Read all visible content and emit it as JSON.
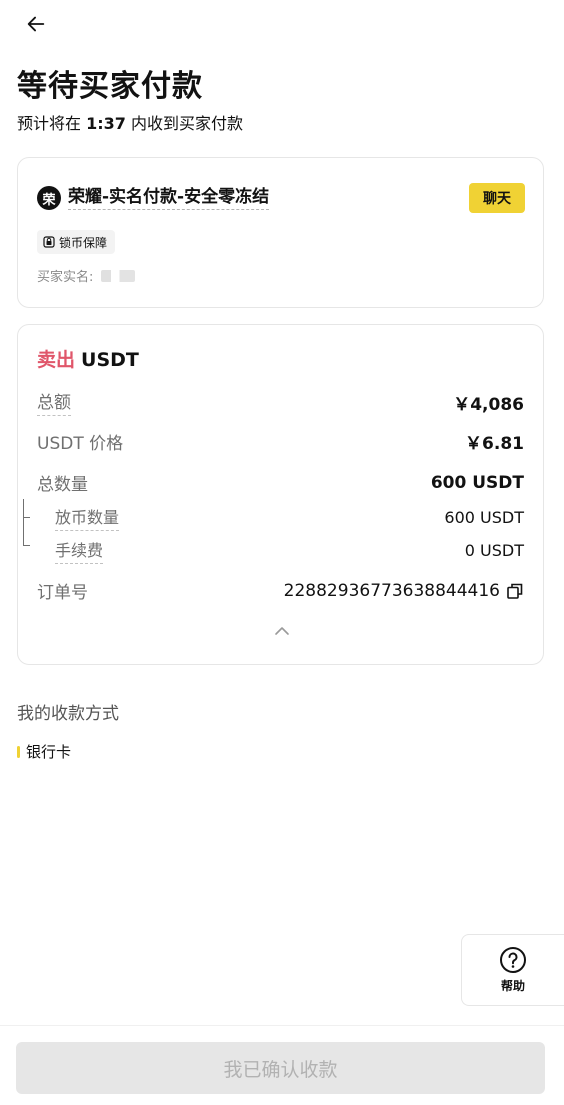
{
  "header": {
    "back_icon": "arrow-left-icon",
    "title": "等待买家付款",
    "subtitle_prefix": "预计将在",
    "countdown": "1:37",
    "subtitle_suffix": "内收到买家付款"
  },
  "merchant_card": {
    "avatar_text": "荣",
    "merchant_name": "荣耀-实名付款-安全零冻结",
    "chat_label": "聊天",
    "badge_icon": "lock-shield-icon",
    "badge_label": "锁币保障",
    "buyer_label": "买家实名:"
  },
  "order_card": {
    "side": "卖出",
    "asset": "USDT",
    "rows": {
      "total_label": "总额",
      "total_value": "￥4,086",
      "price_label": "USDT 价格",
      "price_value": "￥6.81",
      "quantity_label": "总数量",
      "quantity_value": "600 USDT",
      "release_label": "放币数量",
      "release_value": "600 USDT",
      "fee_label": "手续费",
      "fee_value": "0 USDT",
      "order_no_label": "订单号",
      "order_no_value": "22882936773638844416"
    },
    "copy_icon": "copy-icon",
    "collapse_icon": "chevron-up-icon"
  },
  "payment": {
    "section_title": "我的收款方式",
    "method": "银行卡",
    "accent": "#f0d234"
  },
  "help": {
    "icon": "question-circle-icon",
    "label": "帮助"
  },
  "footer": {
    "confirm_label": "我已确认收款"
  },
  "colors": {
    "sell": "#e0566a",
    "primary_yellow": "#f0d234",
    "disabled_bg": "#e6e6e6",
    "disabled_text": "#b2b2b2"
  }
}
